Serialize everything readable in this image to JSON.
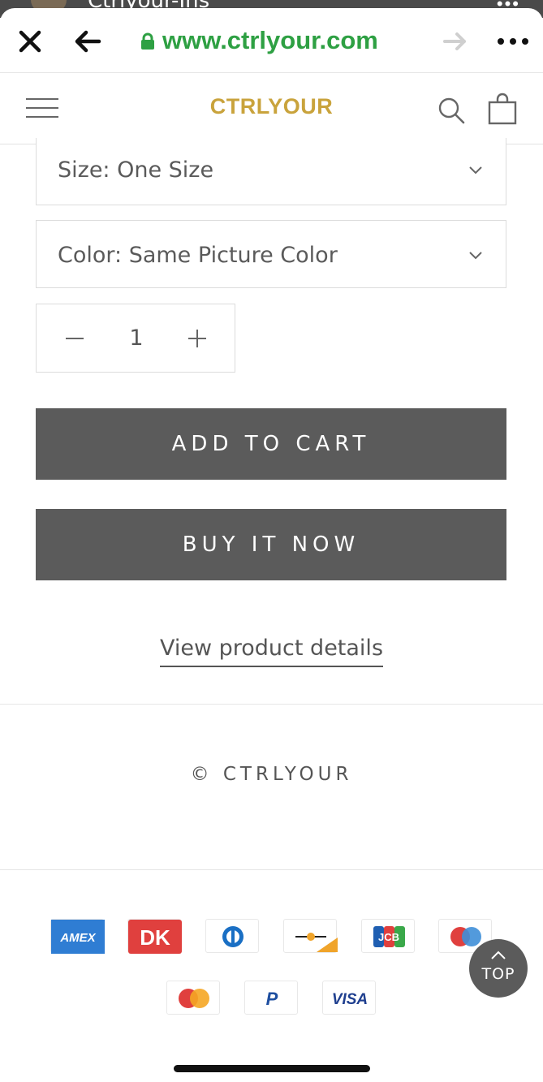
{
  "status_peek": {
    "title": "Ctrlyour-Ins",
    "more": "•••"
  },
  "browser": {
    "url": "www.ctrlyour.com",
    "url_color": "#2ea043",
    "icons": [
      "close-icon",
      "back-arrow-icon",
      "lock-icon",
      "forward-arrow-icon",
      "more-icon"
    ]
  },
  "header": {
    "logo": "CTRLYOUR",
    "logo_color": "#c9a33c",
    "icons": [
      "menu-icon",
      "search-icon",
      "shopping-bag-icon"
    ]
  },
  "product_form": {
    "size_select": {
      "value": "Size: One Size"
    },
    "color_select": {
      "value": "Color: Same Picture Color"
    },
    "quantity": {
      "value": "1",
      "minus": "−",
      "plus": "+"
    },
    "add_to_cart": "ADD TO CART",
    "buy_now": "BUY IT NOW",
    "details_link": "View product details"
  },
  "footer": {
    "copyright": "© CTRLYOUR",
    "payment_methods": [
      {
        "name": "American Express",
        "label": "AMEX"
      },
      {
        "name": "Dankort",
        "label": "DK"
      },
      {
        "name": "Diners Club",
        "label": ""
      },
      {
        "name": "Forbrugsforeningen",
        "label": ""
      },
      {
        "name": "JCB",
        "label": "JCB"
      },
      {
        "name": "Maestro",
        "label": ""
      },
      {
        "name": "Mastercard",
        "label": ""
      },
      {
        "name": "PayPal",
        "label": "P"
      },
      {
        "name": "Visa",
        "label": "VISA"
      }
    ]
  },
  "scroll_top": {
    "label": "TOP"
  },
  "colors": {
    "button_bg": "#5b5b5b",
    "border": "#dcdcdc",
    "text": "#555555"
  }
}
